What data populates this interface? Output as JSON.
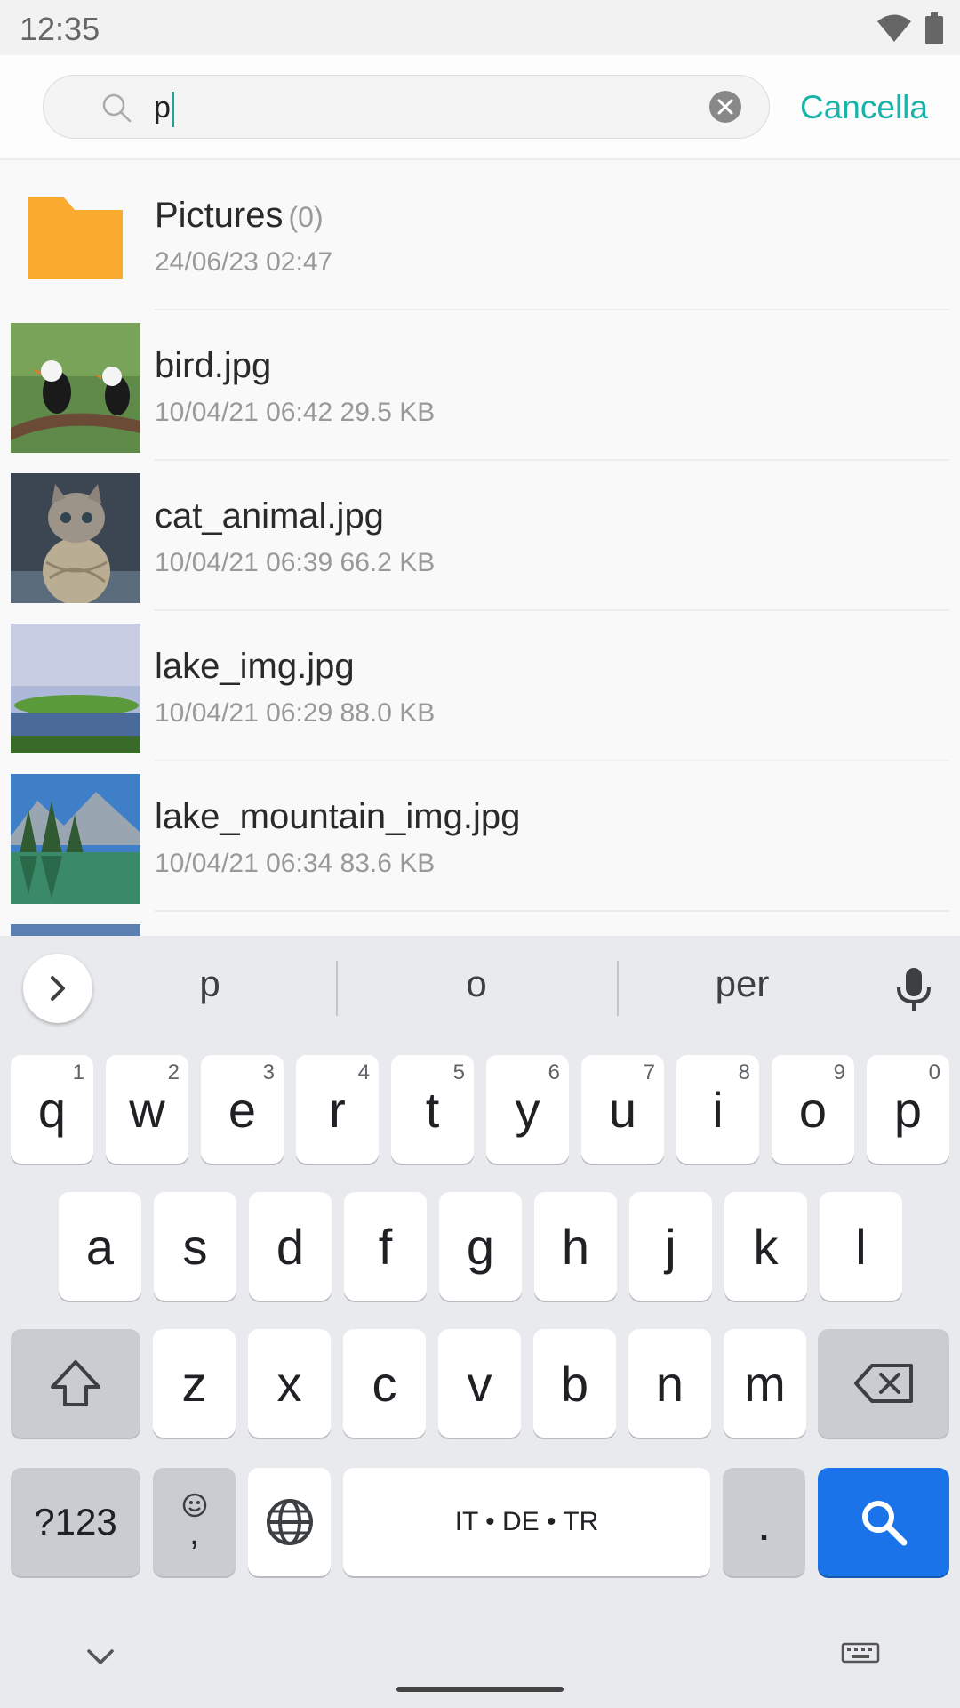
{
  "status_bar": {
    "time": "12:35",
    "icons": [
      "wifi-icon",
      "battery-icon"
    ]
  },
  "search": {
    "query": "p",
    "cancel_label": "Cancella"
  },
  "files": [
    {
      "name": "Pictures",
      "count": "(0)",
      "meta": "24/06/23 02:47",
      "type": "folder"
    },
    {
      "name": "bird.jpg",
      "meta": "10/04/21 06:42 29.5 KB",
      "type": "image"
    },
    {
      "name": "cat_animal.jpg",
      "meta": "10/04/21 06:39 66.2 KB",
      "type": "image"
    },
    {
      "name": "lake_img.jpg",
      "meta": "10/04/21 06:29 88.0 KB",
      "type": "image"
    },
    {
      "name": "lake_mountain_img.jpg",
      "meta": "10/04/21 06:34 83.6 KB",
      "type": "image"
    }
  ],
  "keyboard": {
    "suggestions": [
      "p",
      "o",
      "per"
    ],
    "row1": [
      {
        "key": "q",
        "hint": "1"
      },
      {
        "key": "w",
        "hint": "2"
      },
      {
        "key": "e",
        "hint": "3"
      },
      {
        "key": "r",
        "hint": "4"
      },
      {
        "key": "t",
        "hint": "5"
      },
      {
        "key": "y",
        "hint": "6"
      },
      {
        "key": "u",
        "hint": "7"
      },
      {
        "key": "i",
        "hint": "8"
      },
      {
        "key": "o",
        "hint": "9"
      },
      {
        "key": "p",
        "hint": "0"
      }
    ],
    "row2": [
      "a",
      "s",
      "d",
      "f",
      "g",
      "h",
      "j",
      "k",
      "l"
    ],
    "row3": [
      "z",
      "x",
      "c",
      "v",
      "b",
      "n",
      "m"
    ],
    "symbols_label": "?123",
    "comma_label": ",",
    "space_label": "IT • DE • TR",
    "period_label": "."
  },
  "colors": {
    "accent": "#1ab3a8",
    "folder": "#f9ab2f",
    "search_key": "#1a73e8"
  }
}
